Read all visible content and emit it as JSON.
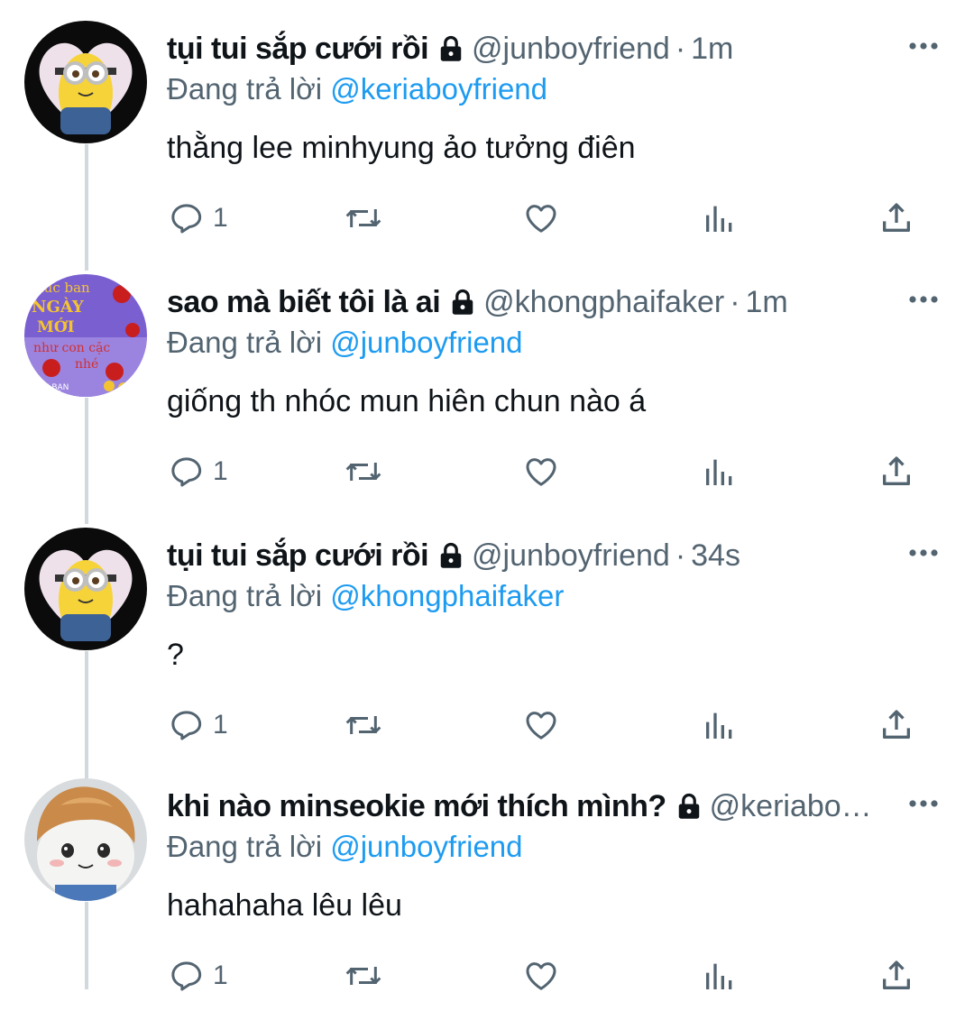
{
  "tweets": [
    {
      "avatar": "minion-heart-avatar",
      "name": "tụi tui sắp cưới rồi",
      "handle": "@junboyfriend",
      "dot": "·",
      "time": "1m",
      "reply_prefix": "Đang trả lời",
      "reply_to": "@keriaboyfriend",
      "text": "thằng lee minhyung ảo tưởng điên",
      "reply_count": "1"
    },
    {
      "avatar": "roses-flower-avatar",
      "avatar_text": {
        "line1": "húc ban",
        "line2": "NGÀY",
        "line3": "MỚI",
        "line4": "như con cặc",
        "line5": "nhé",
        "line6": "ME BẠN"
      },
      "name": "sao mà biết tôi là ai",
      "handle": "@khongphaifaker",
      "dot": "·",
      "time": "1m",
      "reply_prefix": "Đang trả lời",
      "reply_to": "@junboyfriend",
      "text": "giống th nhóc mun hiên chun nào á",
      "reply_count": "1"
    },
    {
      "avatar": "minion-heart-avatar",
      "name": "tụi tui sắp cưới rồi",
      "handle": "@junboyfriend",
      "dot": "·",
      "time": "34s",
      "reply_prefix": "Đang trả lời",
      "reply_to": "@khongphaifaker",
      "text": "?",
      "reply_count": "1"
    },
    {
      "avatar": "plush-doll-avatar",
      "name": "khi nào minseokie mới thích mình?",
      "handle": "@keriabo…",
      "dot": "",
      "time": "",
      "reply_prefix": "Đang trả lời",
      "reply_to": "@junboyfriend",
      "text": "hahahaha lêu lêu",
      "reply_count": "1"
    }
  ],
  "colors": {
    "name": "#0f1419",
    "secondary": "#536471",
    "mention": "#1d9bf0",
    "thread_line": "#cfd9de"
  },
  "icons": [
    "lock-icon",
    "more-icon",
    "reply-icon",
    "retweet-icon",
    "like-icon",
    "views-icon",
    "share-icon"
  ]
}
